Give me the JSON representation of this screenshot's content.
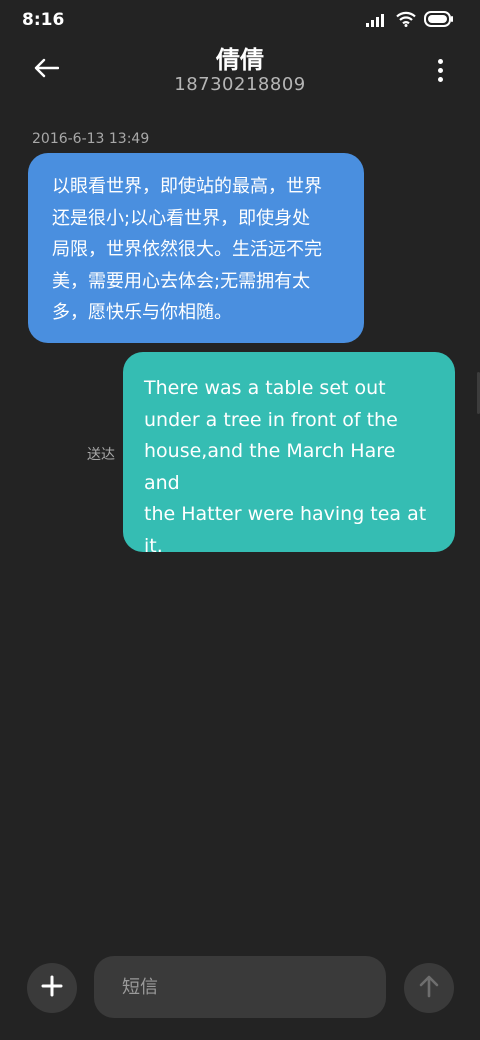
{
  "status_bar": {
    "time": "8:16",
    "icons": [
      "signal-icon",
      "wifi-icon",
      "battery-icon"
    ]
  },
  "header": {
    "contact_name": "倩倩",
    "contact_number": "18730218809",
    "icons": [
      "back-arrow-icon",
      "more-vertical-icon"
    ]
  },
  "conversation": {
    "timestamp": "2016-6-13 13:49",
    "received": {
      "lines": [
        "以眼看世界，即使站的最高，世界",
        "还是很小;以心看世界，即使身处",
        "局限，世界依然很大。生活远不完",
        "美，需要用心去体会;无需拥有太",
        "多，愿快乐与你相随。"
      ]
    },
    "sent": {
      "lines": [
        "There was a table set out",
        "under a tree in front of the",
        "house,and the March Hare and",
        "the Hatter were having tea at",
        "it."
      ],
      "status": "送达"
    }
  },
  "composer": {
    "placeholder": "短信",
    "icons": [
      "plus-icon",
      "send-arrow-icon"
    ]
  },
  "colors": {
    "background": "#232323",
    "received_bubble": "#4a8fdf",
    "sent_bubble": "#35bdb3",
    "control_bg": "#3a3a3a"
  }
}
